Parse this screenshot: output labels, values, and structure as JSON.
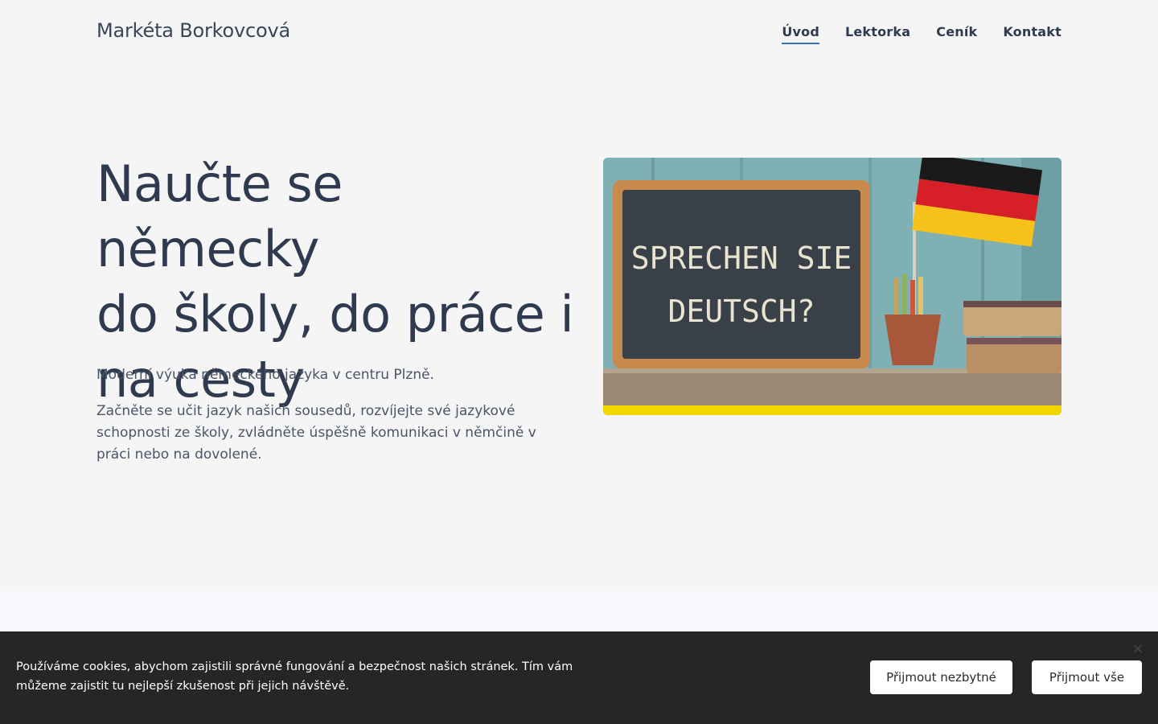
{
  "header": {
    "brand": "Markéta Borkovcová",
    "nav": [
      {
        "label": "Úvod",
        "active": true
      },
      {
        "label": "Lektorka",
        "active": false
      },
      {
        "label": "Ceník",
        "active": false
      },
      {
        "label": "Kontakt",
        "active": false
      }
    ]
  },
  "hero": {
    "title_lines": [
      "Naučte se německy",
      "do školy, do práce i",
      "na cesty"
    ],
    "lead": "Moderní výuka německého jazyka v centru Plzně.",
    "text": "Začněte se učit jazyk našich sousedů, rozvíjejte své jazykové schopnosti ze školy, zvládněte úspěšně komunikaci v němčině v práci nebo na dovolené.",
    "image": {
      "chalk_line1": "SPRECHEN SIE",
      "chalk_line2": "DEUTSCH?",
      "flag_colors": [
        "#1a1a1a",
        "#d61f26",
        "#f6c21a"
      ]
    }
  },
  "cookie_bar": {
    "text": "Používáme cookies, abychom zajistili správné fungování a bezpečnost našich stránek. Tím vám můžeme zajistit tu nejlepší zkušenost při jejich návštěvě.",
    "accept_necessary": "Přijmout nezbytné",
    "accept_all": "Přijmout vše",
    "close_icon": "×"
  },
  "colors": {
    "accent": "#3b6fb6",
    "text": "#2f3a4f",
    "cookie_bg": "#262626"
  }
}
